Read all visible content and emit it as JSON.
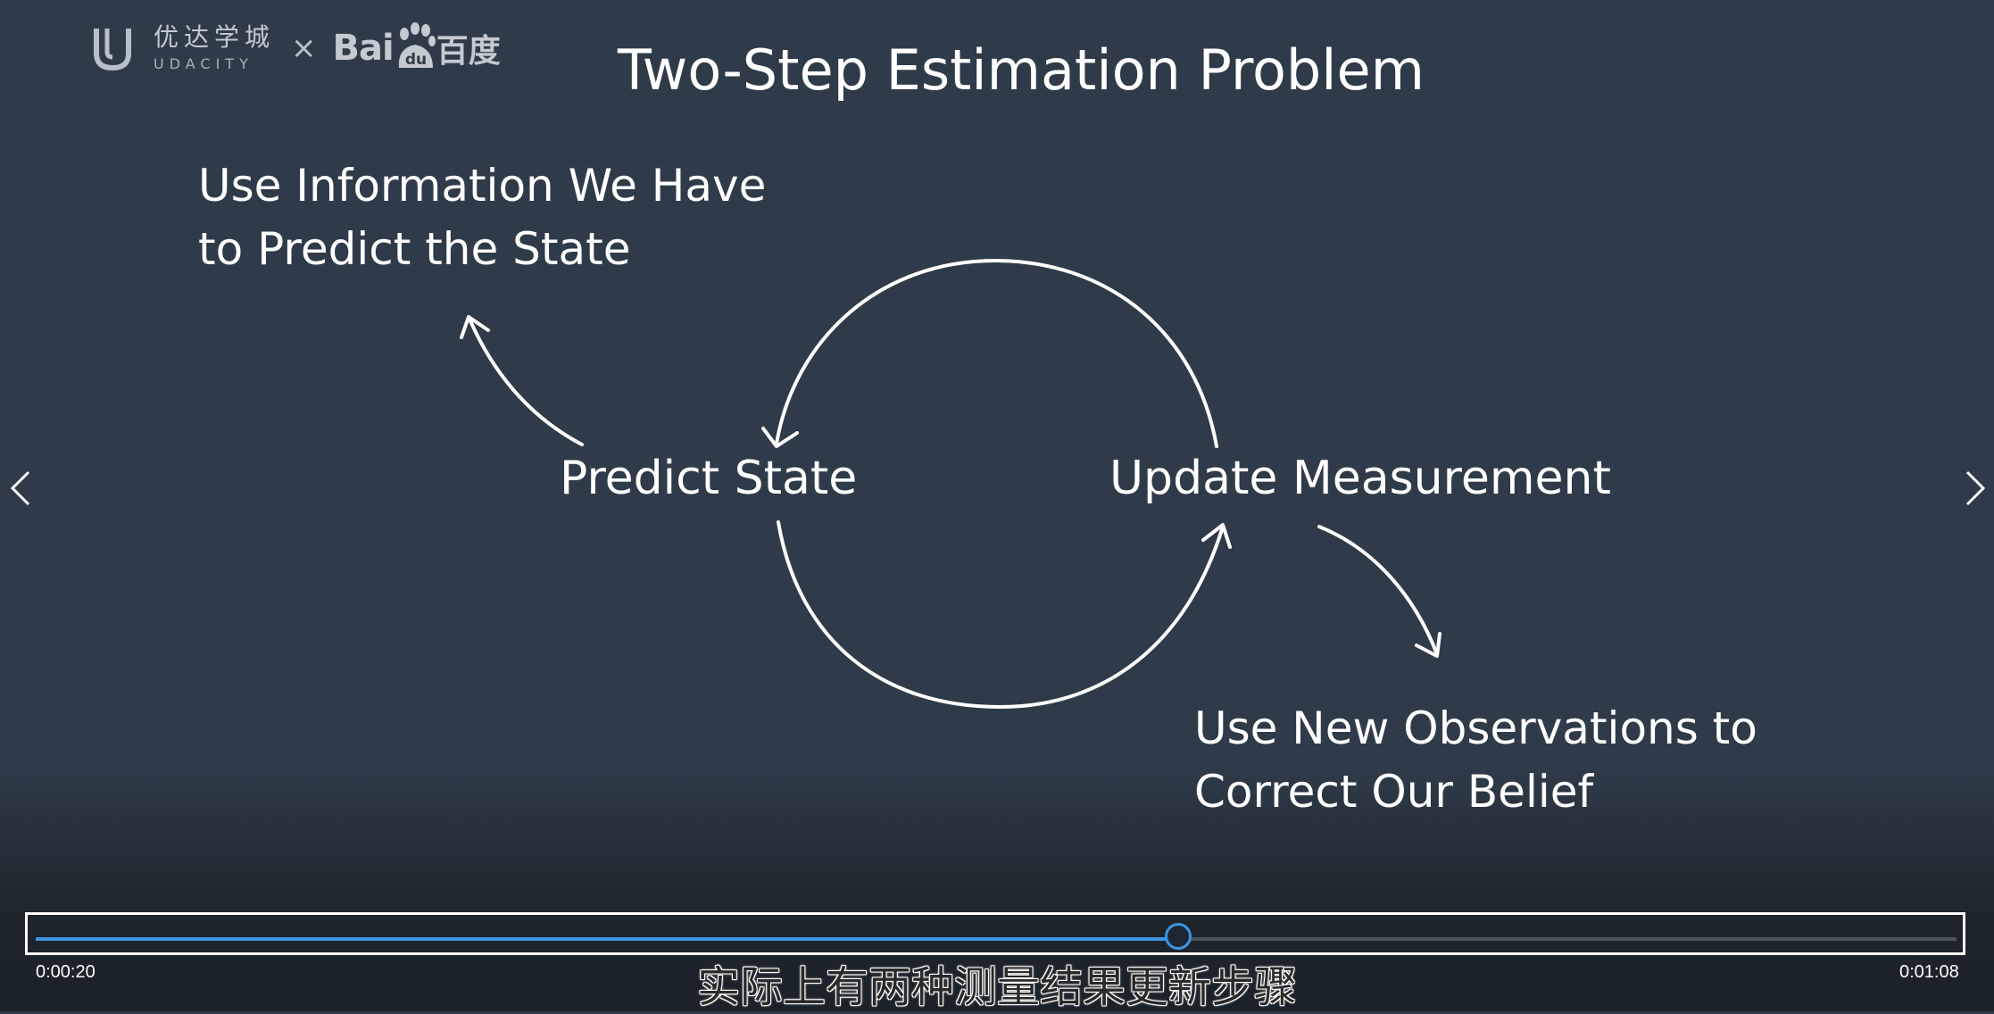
{
  "logo": {
    "udacity_cn": "优达学城",
    "udacity_en": "UDACITY",
    "separator": "×",
    "baidu_text": "Bai",
    "baidu_paw_text": "du",
    "baidu_cn": "百度",
    "icons": [
      "udacity-u-logo",
      "baidu-paw-logo"
    ]
  },
  "slide": {
    "title": "Two-Step Estimation Problem",
    "predict_caption_line1": "Use Information We Have",
    "predict_caption_line2": "to Predict the State",
    "predict_label": "Predict State",
    "update_label": "Update Measurement",
    "update_caption_line1": "Use New Observations to",
    "update_caption_line2": "Correct Our Belief"
  },
  "navigation": {
    "prev_icon": "chevron-left-icon",
    "next_icon": "chevron-right-icon"
  },
  "player": {
    "current_time": "0:00:20",
    "total_time": "0:01:08",
    "progress": 0.595,
    "subtitle": "实际上有两种测量结果更新步骤",
    "colors": {
      "accent": "#3b95e0",
      "background": "#2f3b49"
    }
  }
}
